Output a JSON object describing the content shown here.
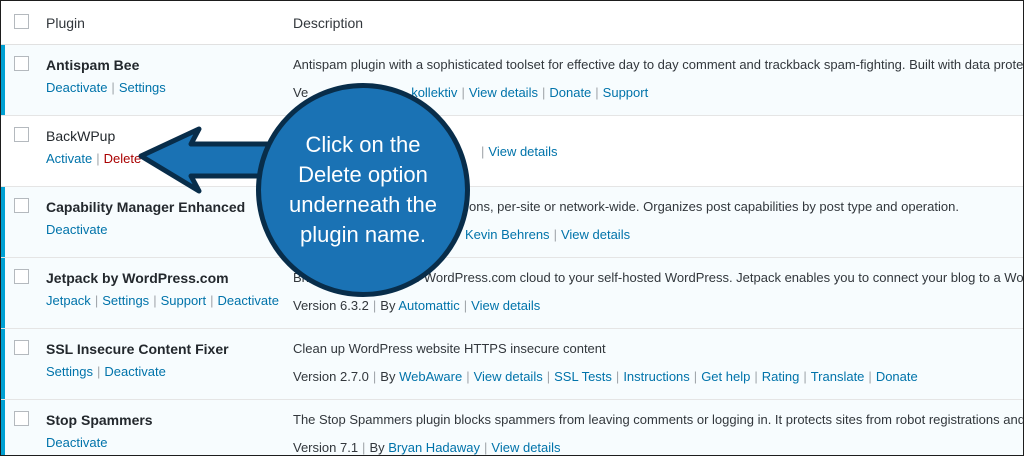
{
  "header": {
    "plugin_label": "Plugin",
    "description_label": "Description"
  },
  "plugins": [
    {
      "name": "Antispam Bee",
      "status": "active",
      "actions": [
        "Deactivate",
        "Settings"
      ],
      "description": "Antispam plugin with a sophisticated toolset for effective day to day comment and trackback spam-fighting. Built with data protection",
      "version_prefix": "Ve",
      "by_tail": "kollektiv",
      "links": [
        "View details",
        "Donate",
        "Support"
      ]
    },
    {
      "name": "BackWPup",
      "status": "inactive",
      "actions": [
        "Activate",
        "Delete"
      ],
      "description": "",
      "version_prefix": "",
      "by_tail": "",
      "links": [
        "View details"
      ]
    },
    {
      "name": "Capability Manager Enhanced",
      "status": "active",
      "actions": [
        "Deactivate"
      ],
      "description": "ons, per-site or network-wide. Organizes post capabilities by post type and operation.",
      "version_prefix": "",
      "by_tail": "Kevin Behrens",
      "links": [
        "View details"
      ]
    },
    {
      "name": "Jetpack by WordPress.com",
      "status": "active",
      "actions": [
        "Jetpack",
        "Settings",
        "Support",
        "Deactivate"
      ],
      "description": "Bring the power of the WordPress.com cloud to your self-hosted WordPress. Jetpack enables you to connect your blog to a WordPress.com account",
      "version": "Version 6.3.2",
      "author": "Automattic",
      "links": [
        "View details"
      ]
    },
    {
      "name": "SSL Insecure Content Fixer",
      "status": "active",
      "actions": [
        "Settings",
        "Deactivate"
      ],
      "description": "Clean up WordPress website HTTPS insecure content",
      "version": "Version 2.7.0",
      "author": "WebAware",
      "links": [
        "View details",
        "SSL Tests",
        "Instructions",
        "Get help",
        "Rating",
        "Translate",
        "Donate"
      ]
    },
    {
      "name": "Stop Spammers",
      "status": "active",
      "actions": [
        "Deactivate"
      ],
      "description": "The Stop Spammers plugin blocks spammers from leaving comments or logging in. It protects sites from robot registrations and malicious attacks",
      "version": "Version 7.1",
      "author": "Bryan Hadaway",
      "links": [
        "View details"
      ]
    }
  ],
  "by_label": "By",
  "callout": {
    "text": "Click on the Delete option underneath the plugin name."
  },
  "colors": {
    "accent": "#00a0d2",
    "link": "#0073aa",
    "delete": "#aa0000",
    "callout_fill": "#1a72b4",
    "callout_border": "#082d4a"
  },
  "icons": [
    "checkbox-icon",
    "arrow-pointer-icon"
  ]
}
